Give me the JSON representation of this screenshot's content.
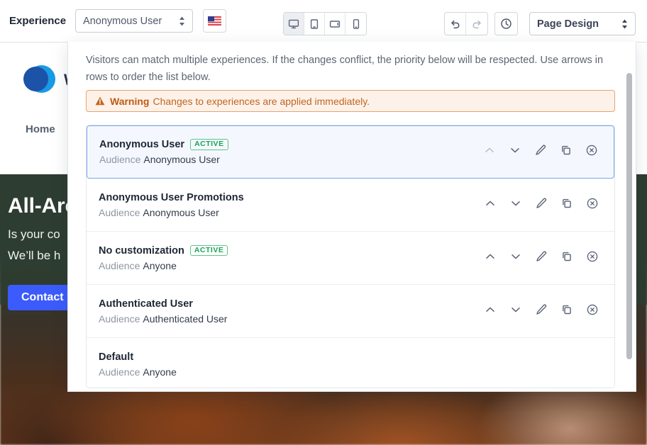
{
  "toolbar": {
    "experience_label": "Experience",
    "experience_value": "Anonymous User",
    "locale_icon": "us-flag-icon",
    "devices": [
      {
        "name": "desktop",
        "icon": "desktop-icon",
        "active": true
      },
      {
        "name": "tablet-portrait",
        "icon": "tablet-portrait-icon",
        "active": false
      },
      {
        "name": "tablet-landscape",
        "icon": "tablet-landscape-icon",
        "active": false
      },
      {
        "name": "mobile",
        "icon": "mobile-icon",
        "active": false
      }
    ],
    "undo_icon": "undo-icon",
    "redo_icon": "redo-icon",
    "history_icon": "clock-icon",
    "mode_value": "Page Design"
  },
  "panel": {
    "description": "Visitors can match multiple experiences. If the changes conflict, the priority below will be respected. Use arrows in rows to order the list below.",
    "warning": {
      "icon": "warning-triangle-icon",
      "strong": "Warning",
      "text": "Changes to experiences are applied immediately."
    },
    "audience_key": "Audience",
    "badge_active": "ACTIVE",
    "rows": [
      {
        "title": "Anonymous User",
        "audience": "Anonymous User",
        "active": true,
        "selected": true,
        "move_up_enabled": false,
        "has_actions": true
      },
      {
        "title": "Anonymous User Promotions",
        "audience": "Anonymous User",
        "active": false,
        "selected": false,
        "move_up_enabled": true,
        "has_actions": true
      },
      {
        "title": "No customization",
        "audience": "Anyone",
        "active": true,
        "selected": false,
        "move_up_enabled": true,
        "has_actions": true
      },
      {
        "title": "Authenticated User",
        "audience": "Authenticated User",
        "active": false,
        "selected": false,
        "move_up_enabled": true,
        "has_actions": true
      },
      {
        "title": "Default",
        "audience": "Anyone",
        "active": false,
        "selected": false,
        "move_up_enabled": false,
        "has_actions": false
      }
    ],
    "action_icons": {
      "move_up": "chevron-up-icon",
      "move_down": "chevron-down-icon",
      "edit": "pencil-icon",
      "duplicate": "copy-icon",
      "delete": "circle-x-icon"
    }
  },
  "site": {
    "logo_icon": "overlapping-circles-logo",
    "brand": "W",
    "nav_home": "Home",
    "hero_title": "All-Aro",
    "hero_line1": "Is your co",
    "hero_line2": "We’ll be h",
    "cta_label": "Contact Us"
  },
  "colors": {
    "accent_blue": "#3b5bfd",
    "selected_row_bg": "#f4f8fe",
    "selected_row_border": "#7aa7e8",
    "badge_green": "#18a558",
    "warning_bg": "#fdf2e9",
    "warning_border": "#e8a36b",
    "warning_text": "#c2651f",
    "hero_overlay": "#2e3d31"
  }
}
